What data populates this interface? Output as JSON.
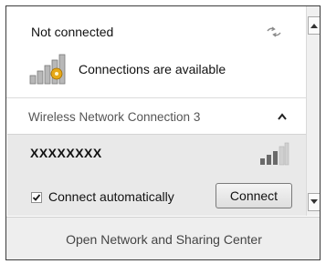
{
  "header": {
    "status": "Not connected",
    "refresh_icon": "refresh-arrows-icon"
  },
  "availability": {
    "text": "Connections are available",
    "icon": "network-signal-bars-icon"
  },
  "adapter": {
    "name": "Wireless Network Connection 3",
    "expanded": true
  },
  "network": {
    "ssid": "XXXXXXXX",
    "signal_icon": "signal-strength-icon",
    "auto_connect": {
      "label": "Connect automatically",
      "checked": true
    },
    "connect_label": "Connect"
  },
  "footer": {
    "link": "Open Network and Sharing Center"
  },
  "colors": {
    "border": "#3c3c3c",
    "selected_bg": "#e9e9e9",
    "footer_bg": "#eeeeee"
  }
}
